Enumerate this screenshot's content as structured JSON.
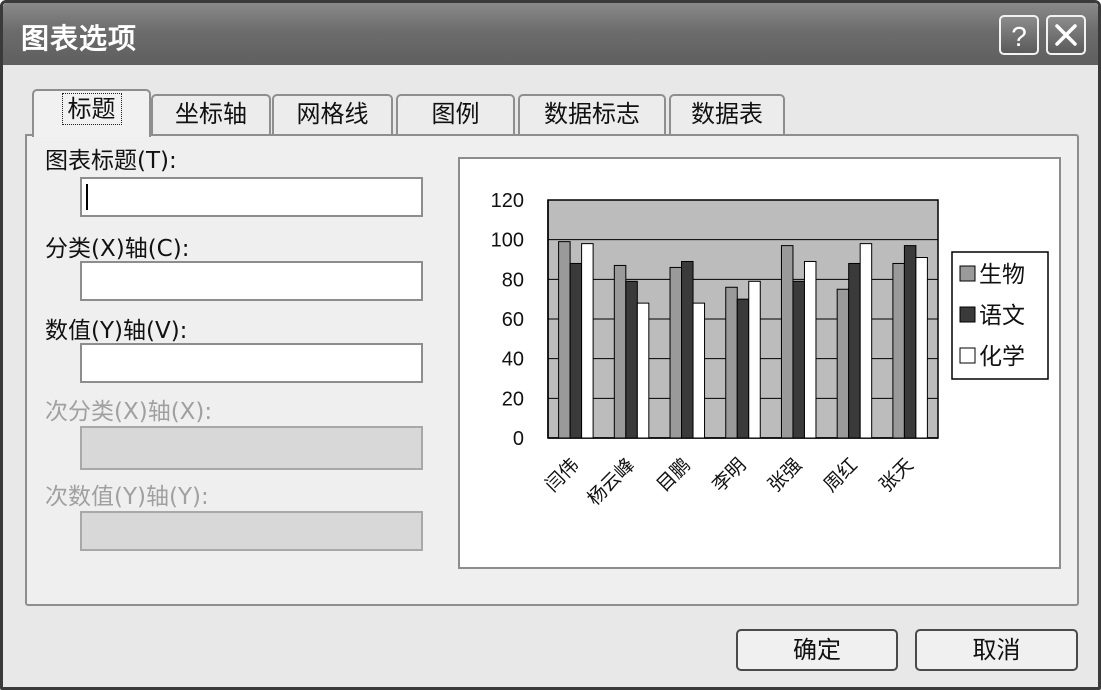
{
  "window": {
    "title": "图表选项"
  },
  "titlebar_buttons": {
    "help_icon": "question-mark-icon",
    "close_icon": "close-icon"
  },
  "tabs": [
    {
      "label": "标题",
      "active": true
    },
    {
      "label": "坐标轴"
    },
    {
      "label": "网格线"
    },
    {
      "label": "图例"
    },
    {
      "label": "数据标志"
    },
    {
      "label": "数据表"
    }
  ],
  "form": {
    "chart_title_label": "图表标题(T):",
    "chart_title_value": "",
    "category_axis_label": "分类(X)轴(C):",
    "category_axis_value": "",
    "value_axis_label": "数值(Y)轴(V):",
    "value_axis_value": "",
    "secondary_category_axis_label": "次分类(X)轴(X):",
    "secondary_value_axis_label": "次数值(Y)轴(Y):"
  },
  "buttons": {
    "ok": "确定",
    "cancel": "取消"
  },
  "chart_data": {
    "type": "bar",
    "categories": [
      "闫伟",
      "杨云峰",
      "目鹏",
      "李明",
      "张强",
      "周红",
      "张天"
    ],
    "series": [
      {
        "name": "生物",
        "values": [
          99,
          87,
          86,
          76,
          97,
          75,
          88
        ],
        "color": "#9a9a9a"
      },
      {
        "name": "语文",
        "values": [
          88,
          79,
          89,
          70,
          79,
          88,
          97
        ],
        "color": "#3a3a3a"
      },
      {
        "name": "化学",
        "values": [
          98,
          68,
          68,
          79,
          89,
          98,
          91
        ],
        "color": "#ffffff"
      }
    ],
    "ylim": [
      0,
      120
    ],
    "yticks": [
      0,
      20,
      40,
      60,
      80,
      100,
      120
    ],
    "grid": true,
    "plot_background": "#bcbcbc",
    "legend": "right"
  }
}
